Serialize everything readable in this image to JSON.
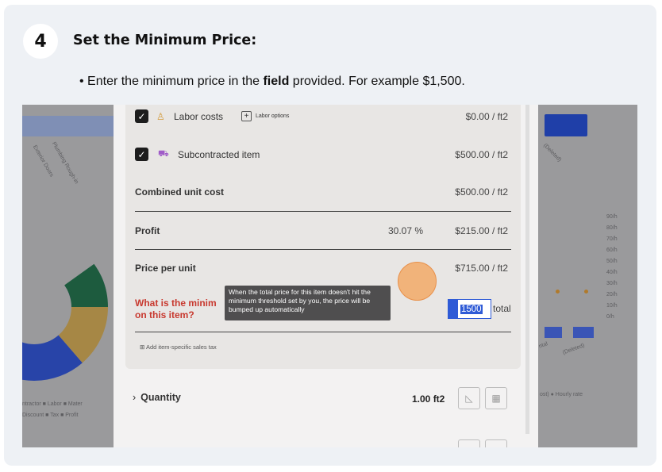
{
  "step": {
    "number": "4",
    "title": "Set the Minimum Price:",
    "instruction_pre": "• Enter the minimum price in the ",
    "instruction_bold": "field",
    "instruction_post": " provided. For example $1,500."
  },
  "screenshot": {
    "rows": {
      "labor": {
        "label": "Labor costs",
        "option": "Labor options",
        "amount": "$0.00 / ft2"
      },
      "subcontracted": {
        "label": "Subcontracted item",
        "amount": "$500.00 / ft2"
      },
      "combined": {
        "label": "Combined unit cost",
        "amount": "$500.00 / ft2"
      },
      "profit": {
        "label": "Profit",
        "percent": "30.07 %",
        "amount": "$215.00 / ft2"
      },
      "price_per_unit": {
        "label": "Price per unit",
        "amount": "$715.00 / ft2"
      }
    },
    "min_price": {
      "question_line1": "What is the minim",
      "question_line2": "on this item?",
      "value": "1500",
      "suffix": "total"
    },
    "tooltip": "When the total price for this item doesn't hit the minimum threshold set by you, the price will be bumped up automatically",
    "sales_tax_link": "⊞ Add item-specific sales tax",
    "quantity": {
      "label": "Quantity",
      "value": "1.00 ft2"
    },
    "background_left": {
      "legend1": "ntractor  ■ Labor  ■ Mater",
      "legend2": "Discount  ■ Tax  ■ Profit",
      "axis1": "Exterior Doors",
      "axis2": "Plumbing Rough-in"
    },
    "background_right": {
      "ticks": [
        "90/h",
        "80/h",
        "70/h",
        "60/h",
        "50/h",
        "40/h",
        "30/h",
        "20/h",
        "10/h",
        "0/h"
      ],
      "legend": "ost)  ● Hourly rate",
      "deleted1": "(Deleted)",
      "deleted2": "(Deleted)",
      "ntal": "ntal"
    }
  }
}
